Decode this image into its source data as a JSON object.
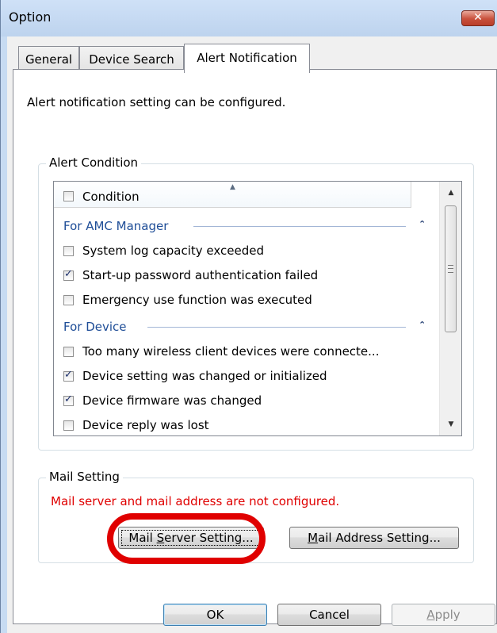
{
  "window": {
    "title": "Option",
    "close_label": "✕"
  },
  "tabs": [
    {
      "label": "General",
      "active": false
    },
    {
      "label": "Device Search",
      "active": false
    },
    {
      "label": "Alert Notification",
      "active": true
    }
  ],
  "description": "Alert notification setting can be configured.",
  "alert_condition": {
    "group_label": "Alert Condition",
    "column_header": "Condition",
    "groups": [
      {
        "title": "For AMC Manager",
        "items": [
          {
            "label": "System log capacity exceeded",
            "checked": false
          },
          {
            "label": "Start-up password authentication failed",
            "checked": true
          },
          {
            "label": "Emergency use function was executed",
            "checked": false
          }
        ]
      },
      {
        "title": "For Device",
        "items": [
          {
            "label": "Too many wireless client devices were connecte...",
            "checked": false
          },
          {
            "label": "Device setting was changed or initialized",
            "checked": true
          },
          {
            "label": "Device firmware was changed",
            "checked": true
          },
          {
            "label": "Device reply was lost",
            "checked": false
          }
        ]
      }
    ]
  },
  "mail_setting": {
    "group_label": "Mail Setting",
    "warning": "Mail server and mail address are not configured.",
    "warning_color": "#e00000",
    "server_button": {
      "prefix": "Mail ",
      "mnemonic": "S",
      "suffix": "erver Setting..."
    },
    "address_button": {
      "mnemonic": "M",
      "suffix": "ail Address Setting..."
    }
  },
  "footer": {
    "ok": "OK",
    "cancel": "Cancel",
    "apply": {
      "mnemonic": "A",
      "suffix": "pply"
    }
  },
  "icons": {
    "collapse": "chevron-up",
    "scroll_up": "triangle-up",
    "scroll_down": "triangle-down"
  }
}
